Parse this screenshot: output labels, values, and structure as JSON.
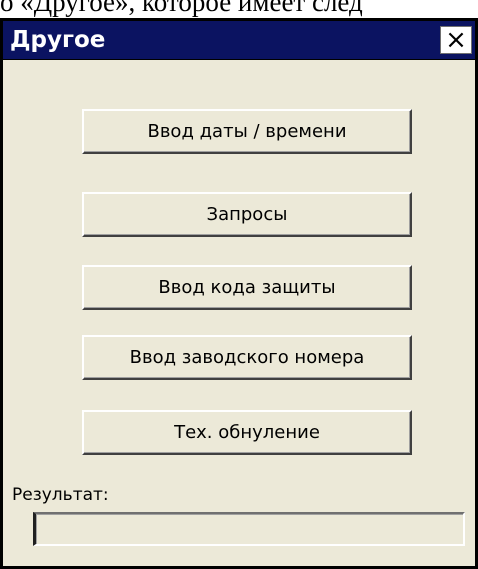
{
  "document_fragment": "о «Другое», которое имеет след",
  "window": {
    "title": "Другое",
    "close_symbol": "×",
    "title_bar_color": "#0b1361",
    "background_color": "#ece9d8"
  },
  "buttons": [
    {
      "label": "Ввод даты / времени"
    },
    {
      "label": "Запросы"
    },
    {
      "label": "Ввод кода защиты"
    },
    {
      "label": "Ввод заводского номера"
    },
    {
      "label": "Тех. обнуление"
    }
  ],
  "result": {
    "label": "Результат:",
    "value": ""
  },
  "icons": {
    "close": "close-icon"
  }
}
